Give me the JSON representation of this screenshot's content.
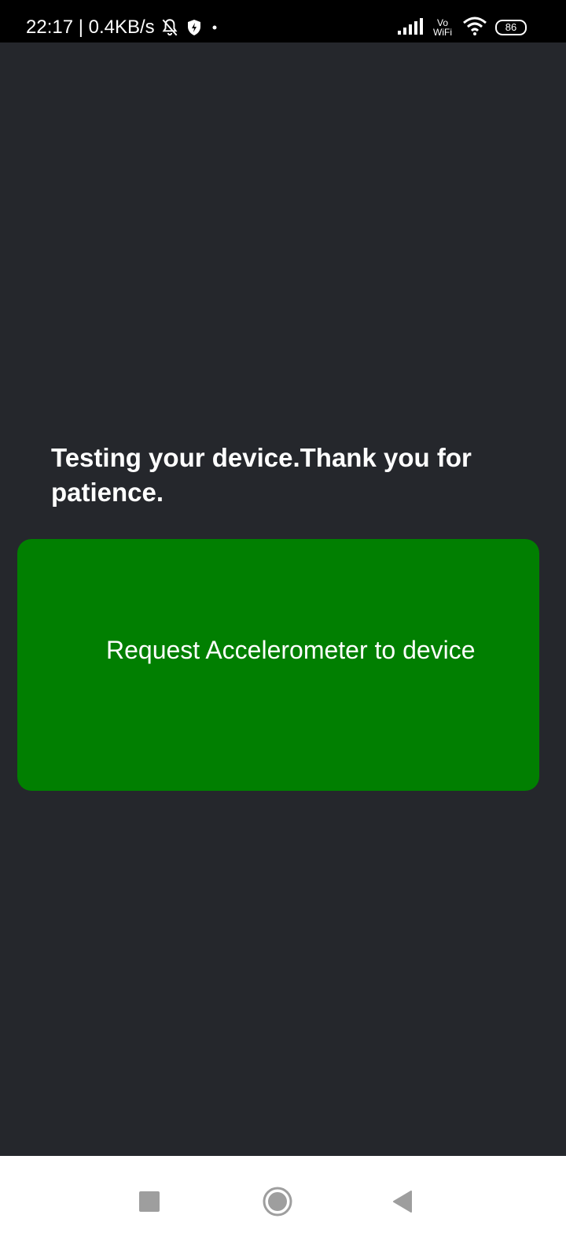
{
  "status_bar": {
    "time_speed": "22:17 | 0.4KB/s",
    "vowifi_top": "Vo",
    "vowifi_bottom": "WiFi",
    "battery_level": "86",
    "icons": [
      "bell-off-icon",
      "shield-icon",
      "notification-dot-icon",
      "signal-icon",
      "wifi-icon",
      "battery-icon"
    ]
  },
  "main": {
    "message": "Testing your device.Thank you for patience.",
    "request_button_label": "Request Accelerometer to device"
  },
  "nav_bar": {
    "icons": [
      "recents-icon",
      "home-icon",
      "back-icon"
    ]
  },
  "colors": {
    "background": "#25272c",
    "button": "#017f01",
    "status_bar": "#000000",
    "nav_bar": "#ffffff"
  }
}
